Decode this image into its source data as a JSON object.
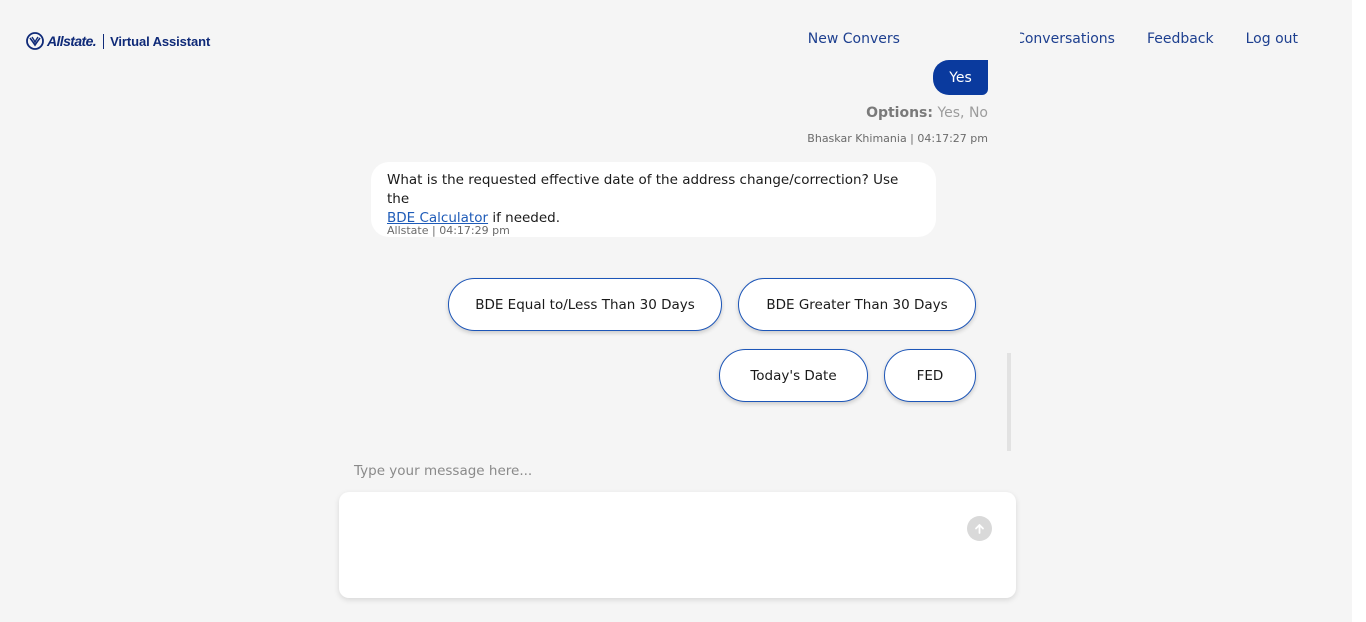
{
  "header": {
    "brand": "Allstate.",
    "product": "Virtual Assistant",
    "nav": [
      {
        "label": "New Conversation"
      },
      {
        "label": "Active Conversations"
      },
      {
        "label": "Feedback"
      },
      {
        "label": "Log out"
      }
    ]
  },
  "chat": {
    "user_message": {
      "text": "Yes",
      "options_label": "Options:",
      "options_values": "Yes, No",
      "meta": "Bhaskar Khimania | 04:17:27 pm"
    },
    "bot_message": {
      "text_before": "What is the requested effective date of the address change/correction? Use the",
      "link_text": "BDE Calculator",
      "text_after": "if needed.",
      "meta": "Allstate | 04:17:29 pm"
    },
    "quick_replies": [
      {
        "label": "BDE Equal to/Less Than 30 Days"
      },
      {
        "label": "BDE Greater Than 30 Days"
      },
      {
        "label": "Today's Date"
      },
      {
        "label": "FED"
      }
    ]
  },
  "composer": {
    "label": "Type your message here...",
    "value": ""
  },
  "icons": {
    "logo": "allstate-hands-icon",
    "send": "arrow-up-circle-icon"
  },
  "colors": {
    "brand": "#0f2a78",
    "nav_link": "#1d3f8f",
    "user_bubble": "#0a3a9e",
    "quick_reply_border": "#1d56b8",
    "link": "#1e5bb8"
  }
}
